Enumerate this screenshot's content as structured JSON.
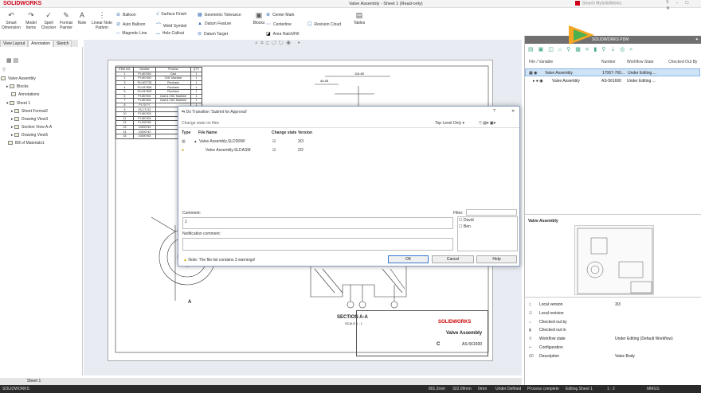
{
  "app": {
    "brand": "SOLIDWORKS",
    "window_title": "Valve Assembly - Sheet 1 (Read-only)",
    "search_placeholder": "Search MySolidWorks",
    "window_controls": "? - □ ✕"
  },
  "ribbon": {
    "large_buttons": [
      "Smart Dimension",
      "Model Items",
      "Spell Checker",
      "Format Painter",
      "Note",
      "Linear Note Pattern",
      "Blocks",
      "Tables"
    ],
    "items": [
      "Balloon",
      "Auto Balloon",
      "Magnetic Line",
      "Surface Finish",
      "Weld Symbol",
      "Hole Callout",
      "Geometric Tolerance",
      "Datum Feature",
      "Datum Target",
      "Center Mark",
      "Centerline",
      "Area Hatch/Fill",
      "Revision Cloud"
    ]
  },
  "tabs": [
    "View Layout",
    "Annotation",
    "Sketch"
  ],
  "tree": {
    "root": "Valve Assembly",
    "items": [
      "Blocks",
      "Annotations",
      "Sheet 1",
      "Sheet Format2",
      "Drawing View3",
      "Section View A-A",
      "Drawing View5",
      "Bill of Materials1"
    ]
  },
  "bom": {
    "headers": [
      "ITEM NO.",
      "Number",
      "Process",
      "QTY."
    ],
    "rows": [
      [
        "1",
        "PI-46?240",
        "Cast",
        "1"
      ],
      [
        "2",
        "PI-56?400",
        "CNC Machine",
        "1"
      ],
      [
        "3",
        "PU-60?730",
        "Purchase",
        "1"
      ],
      [
        "4",
        "PU-61?863",
        "Purchase",
        "1"
      ],
      [
        "5",
        "PU-61?820",
        "Purchase",
        "1"
      ],
      [
        "6",
        "PI-56?401",
        "Cast & CNC Machine",
        "1"
      ],
      [
        "7",
        "PI-56?402",
        "Cast & CNC Machine",
        "1"
      ],
      [
        "8",
        "PI-?0??7",
        "",
        "1"
      ],
      [
        "9",
        "PU-71?12",
        "",
        "1"
      ],
      [
        "10",
        "PI-56?403",
        "",
        "1"
      ],
      [
        "11",
        "PI-56?404",
        "",
        "1"
      ],
      [
        "12",
        "PI-000?50",
        "",
        "1"
      ],
      [
        "13",
        "10000?43",
        "",
        "1"
      ],
      [
        "14",
        "10000?42",
        "",
        "1"
      ],
      [
        "15",
        "10000?63",
        "",
        "1"
      ]
    ]
  },
  "drawing": {
    "section_title": "SECTION A-A",
    "section_scale": "SCALE 1 : 1",
    "tb_brand": "SOLIDWORKS",
    "tb_name": "Valve Assembly",
    "tb_rev": "C",
    "tb_number": "AS-561600",
    "dim1": "116.80",
    "dim2": "44.45"
  },
  "dialog": {
    "title": "Do Transition 'Submit for Approval'",
    "subtitle": "Change state on files",
    "view_option": "Top Level Only ▾",
    "help": "?",
    "close": "✕",
    "columns": [
      "Type",
      "File Name",
      "Change state",
      "Version"
    ],
    "files": [
      {
        "name": "Valve Assembly.SLDDRW",
        "state": "☑",
        "version": "3/3"
      },
      {
        "name": "Valve Assembly.SLDASM",
        "state": "☑",
        "version": "2/2"
      }
    ],
    "comment_label": "Comment:",
    "comment_value": "1",
    "notification_label": "Notification comment:",
    "filter_label": "Filter:",
    "users": [
      "David",
      "Ben"
    ],
    "note": "Note: The file list contains 3 warnings!",
    "ok": "OK",
    "cancel": "Cancel",
    "helpbtn": "Help"
  },
  "pdm": {
    "header": "SOLIDWORKS PDM",
    "columns": [
      "File / Variable",
      "Number",
      "Workflow State",
      "Checked Out By"
    ],
    "rows": [
      {
        "name": "Valve Assembly",
        "number": "17067-760...",
        "state": "Under Editing ..."
      },
      {
        "name": "Valve Assembly",
        "number": "AS-561600",
        "state": "Under Editing ..."
      }
    ],
    "preview_title": "Valve Assembly",
    "props": [
      {
        "label": "Local version",
        "value": "3/3"
      },
      {
        "label": "Local revision",
        "value": ""
      },
      {
        "label": "Checked out by",
        "value": ""
      },
      {
        "label": "Checked out in",
        "value": ""
      },
      {
        "label": "Workflow state",
        "value": "Under Editing (Default Workflow)"
      },
      {
        "label": "Configuration",
        "value": ""
      },
      {
        "label": "Description",
        "value": "Valve Body"
      }
    ]
  },
  "sheet_tab": "Sheet 1",
  "status": {
    "app": "SOLIDWORKS",
    "x": "801.2mm",
    "y": "322.09mm",
    "z": "0mm",
    "def": "Under Defined",
    "proc": "Process complete",
    "edit": "Editing Sheet 1",
    "scale": "1 : 2",
    "units": "MMGS"
  }
}
